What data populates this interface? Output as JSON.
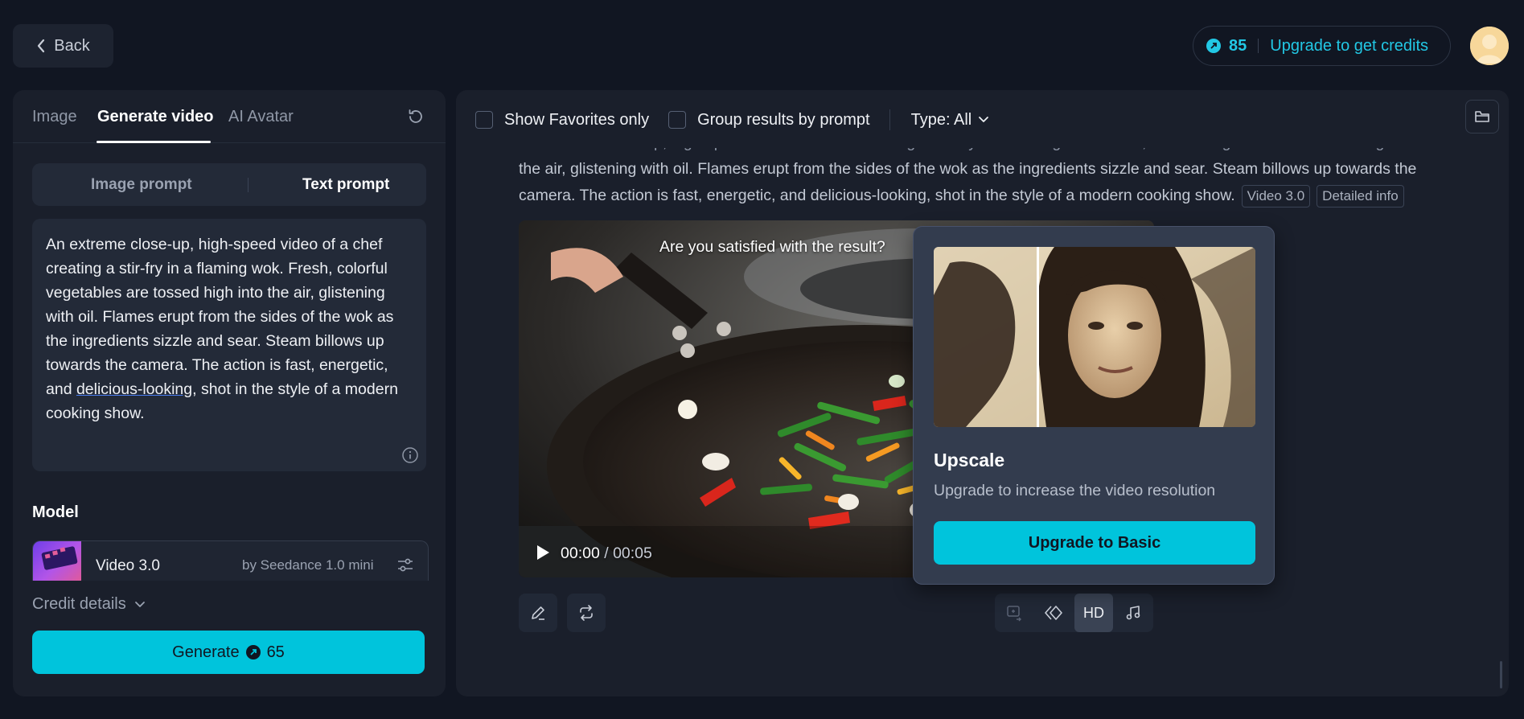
{
  "header": {
    "back_label": "Back",
    "credits": "85",
    "upgrade_label": "Upgrade to get credits"
  },
  "left_panel": {
    "tabs": [
      {
        "label": "Image"
      },
      {
        "label": "Generate video"
      },
      {
        "label": "AI Avatar"
      }
    ],
    "active_tab": "Generate video",
    "prompt_modes": [
      "Image prompt",
      "Text prompt"
    ],
    "active_prompt_mode": "Text prompt",
    "prompt_text_before": "An extreme close-up, high-speed video of a chef creating a stir-fry in a flaming wok. Fresh, colorful vegetables are tossed high into the air, glistening with oil. Flames erupt from the sides of the wok as the ingredients sizzle and sear. Steam billows up towards the camera. The action is fast, energetic, and ",
    "prompt_text_underlined": "delicious-looking",
    "prompt_text_after": ", shot in the style of a modern cooking show.",
    "model_label": "Model",
    "model_name": "Video 3.0",
    "model_provider": "by Seedance 1.0 mini",
    "credit_details_label": "Credit details",
    "generate_label": "Generate",
    "generate_cost": "65"
  },
  "results": {
    "show_favorites_label": "Show Favorites only",
    "group_results_label": "Group results by prompt",
    "type_label": "Type: All",
    "prompt_line_1": "An extreme close-up, high-speed video of a chef creating a stir-fry in a flaming wok. Fresh, colorful vegetables are tossed high into",
    "prompt_line_2": "the air, glistening with oil. Flames erupt from the sides of the wok as the ingredients sizzle and sear. Steam billows up towards the",
    "prompt_line_3": "camera. The action is fast, energetic, and delicious-looking, shot in the style of a modern cooking show.",
    "model_tag": "Video 3.0",
    "detailed_info_label": "Detailed info",
    "video_question": "Are you satisfied with the result?",
    "video_current_time": "00:00",
    "video_duration": "/ 00:05",
    "hd_label": "HD"
  },
  "upscale_popover": {
    "title": "Upscale",
    "description": "Upgrade to increase the video resolution",
    "button_label": "Upgrade to Basic"
  },
  "colors": {
    "accent": "#00c4dc",
    "background": "#111622",
    "panel": "#1a1f2b"
  }
}
